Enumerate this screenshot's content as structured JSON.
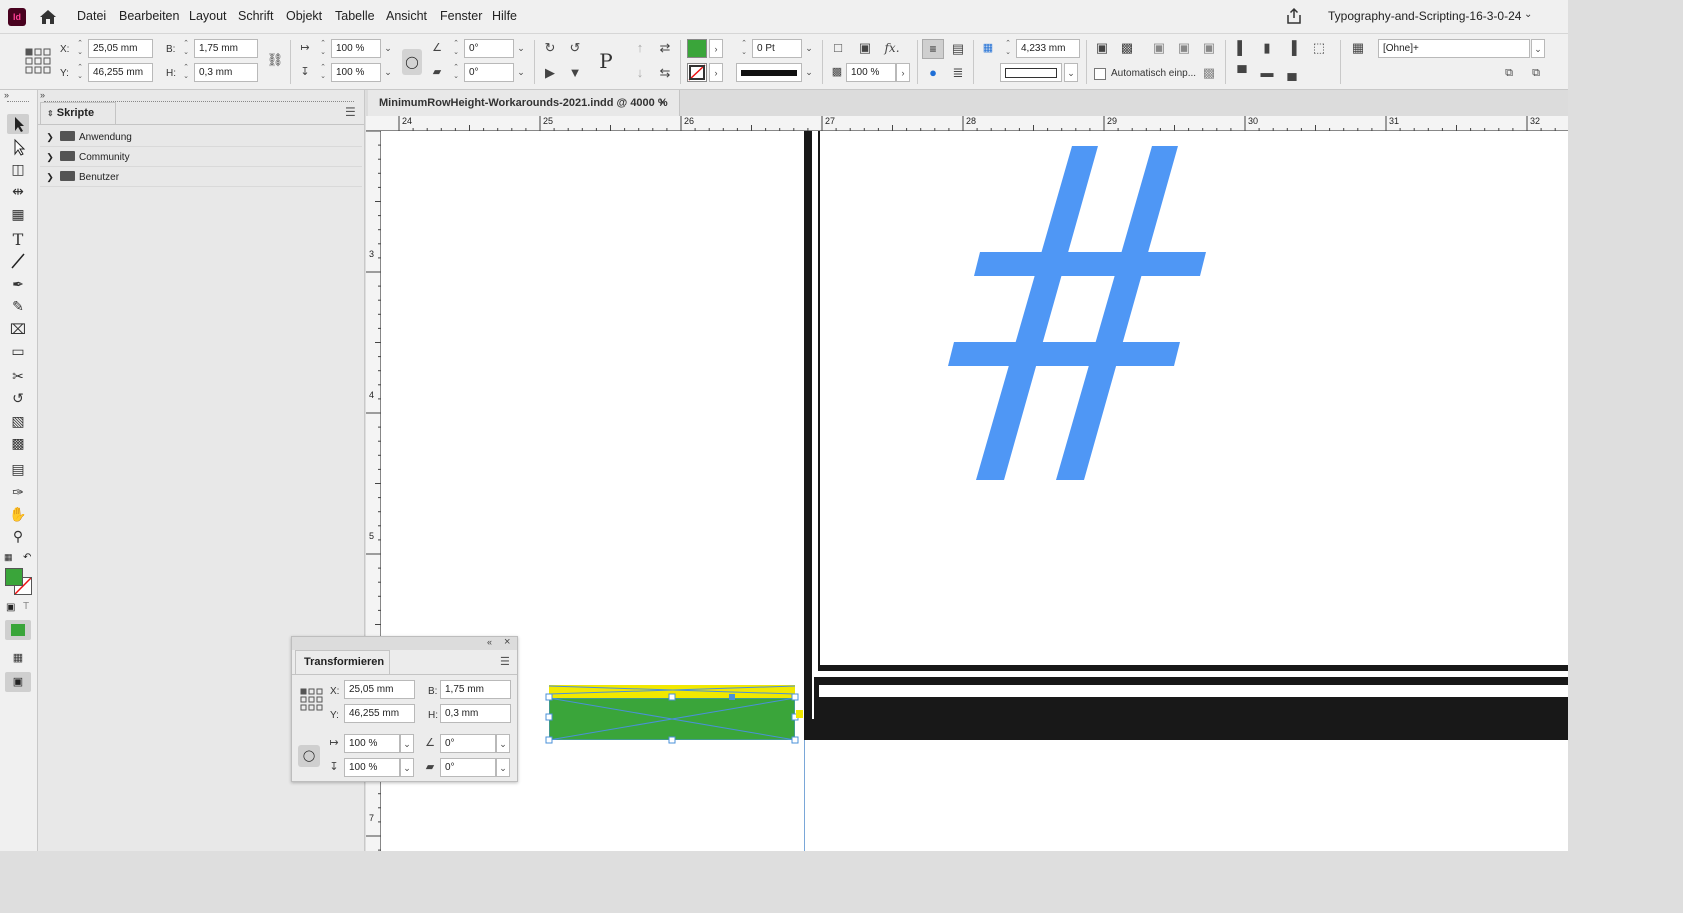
{
  "app": {
    "logo": "Id",
    "workspace": "Typography-and-Scripting-16-3-0-24"
  },
  "menu": [
    "Datei",
    "Bearbeiten",
    "Layout",
    "Schrift",
    "Objekt",
    "Tabelle",
    "Ansicht",
    "Fenster",
    "Hilfe"
  ],
  "control": {
    "x_label": "X:",
    "x": "25,05 mm",
    "y_label": "Y:",
    "y": "46,255 mm",
    "w_label": "B:",
    "w": "1,75 mm",
    "h_label": "H:",
    "h": "0,3 mm",
    "scale_x": "100 %",
    "scale_y": "100 %",
    "rotate": "0°",
    "shear": "0°",
    "stroke_weight": "0 Pt",
    "opacity": "100 %",
    "fx": "fx.",
    "gap": "4,233 mm",
    "autofit_label": "Automatisch einp...",
    "object_style": "[Ohne]+",
    "fill_color": "#3aa53a"
  },
  "panel": {
    "title": "Skripte",
    "items": [
      {
        "label": "Anwendung"
      },
      {
        "label": "Community"
      },
      {
        "label": "Benutzer"
      }
    ]
  },
  "document": {
    "tab_title": "MinimumRowHeight-Workarounds-2021.indd @ 4000 %",
    "ruler_h": [
      "24",
      "25",
      "26",
      "27",
      "28",
      "29",
      "30",
      "31",
      "32"
    ],
    "ruler_v": [
      "3",
      "4",
      "5",
      "7"
    ],
    "glyph": "#",
    "glyph_color": "#4f97f5"
  },
  "transform_panel": {
    "title": "Transformieren",
    "x_label": "X:",
    "x": "25,05 mm",
    "y_label": "Y:",
    "y": "46,255 mm",
    "w_label": "B:",
    "w": "1,75 mm",
    "h_label": "H:",
    "h": "0,3 mm",
    "scale_x": "100 %",
    "scale_y": "100 %",
    "rotate": "0°",
    "shear": "0°"
  }
}
